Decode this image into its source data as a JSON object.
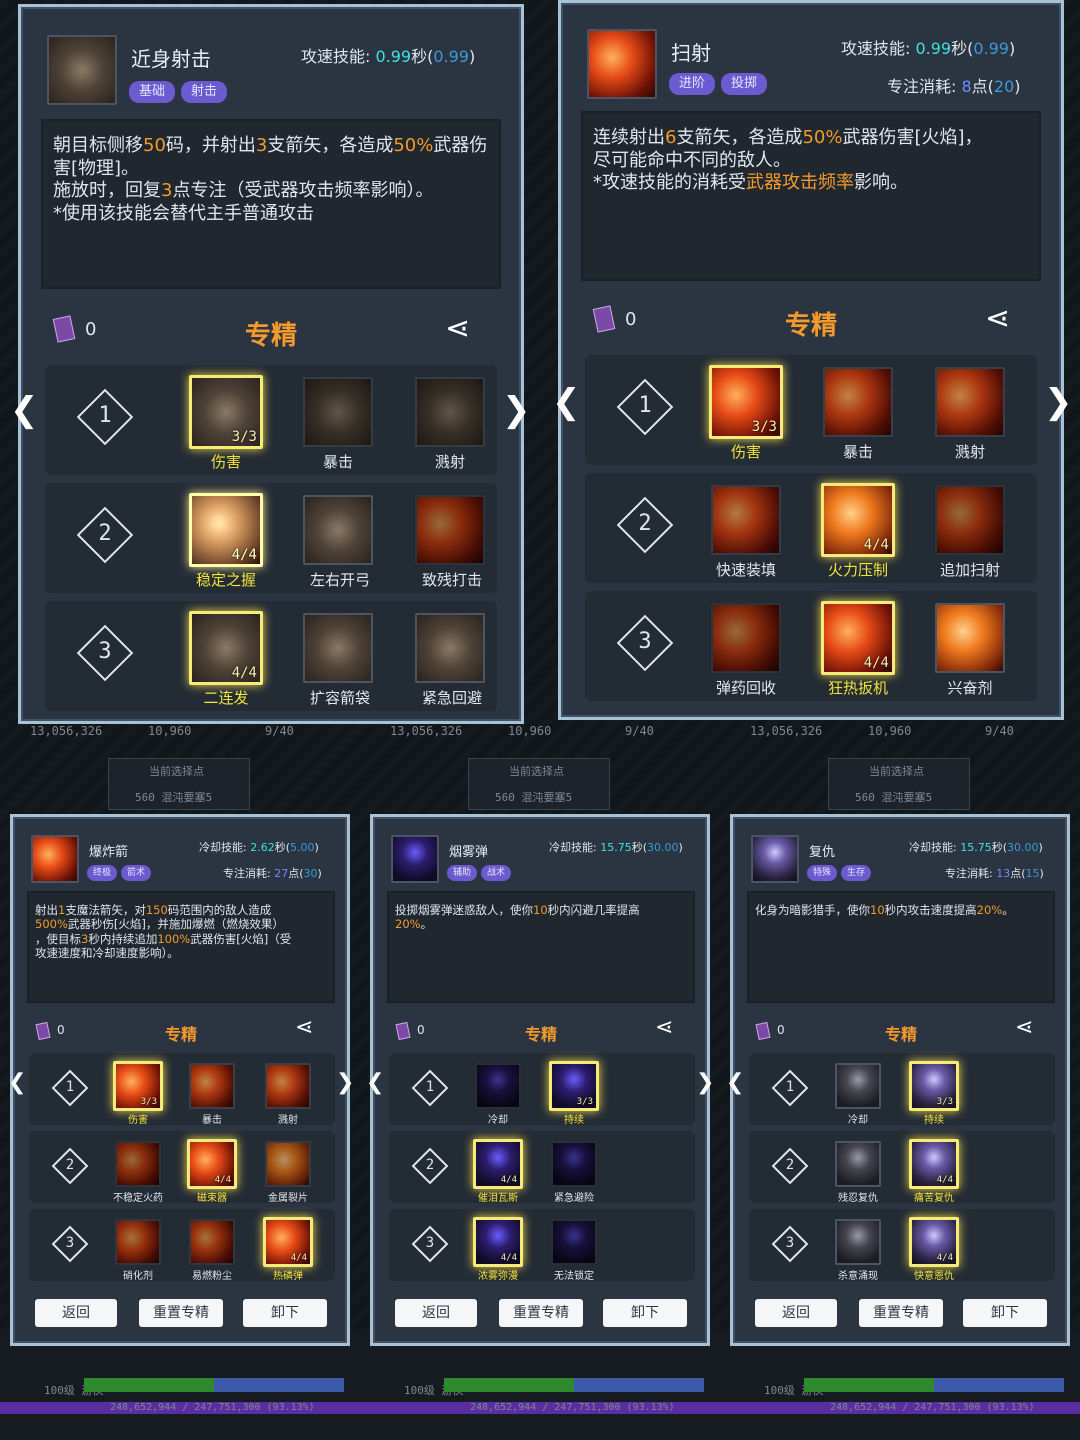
{
  "top_left": {
    "title": "近身射击",
    "cost_label": "攻速技能: ",
    "cost_val": "0.99",
    "cost_unit": "秒(",
    "cost_base": "0.99",
    "cost_close": ")",
    "tags": [
      "基础",
      "射击"
    ],
    "desc_parts": [
      "朝目标侧移",
      "50",
      "码，并射出",
      "3",
      "支箭矢，各造成",
      "50%",
      "武器伤害[物理]。",
      "施放时，回复",
      "3",
      "点专注（受武器攻击频率影响）。",
      "*使用该技能会替代主手普通攻击"
    ],
    "book": "0",
    "spec": "专精",
    "rows": [
      {
        "n": "1",
        "items": [
          {
            "name": "伤害",
            "count": "3/3",
            "sel": true
          },
          {
            "name": "暴击"
          },
          {
            "name": "溅射"
          }
        ]
      },
      {
        "n": "2",
        "items": [
          {
            "name": "稳定之握",
            "count": "4/4",
            "sel": true
          },
          {
            "name": "左右开弓"
          },
          {
            "name": "致残打击"
          }
        ]
      },
      {
        "n": "3",
        "items": [
          {
            "name": "二连发",
            "count": "4/4",
            "sel": true
          },
          {
            "name": "扩容箭袋"
          },
          {
            "name": "紧急回避"
          }
        ]
      }
    ]
  },
  "top_right": {
    "title": "扫射",
    "cost_label": "攻速技能: ",
    "cost_val": "0.99",
    "cost_unit": "秒(",
    "cost_base": "0.99",
    "cost_close": ")",
    "focus_label": "专注消耗: ",
    "focus_val": "8",
    "focus_unit": "点(",
    "focus_base": "20",
    "focus_close": ")",
    "tags": [
      "进阶",
      "投掷"
    ],
    "desc_parts": [
      "连续射出",
      "6",
      "支箭矢，各造成",
      "50%",
      "武器伤害[火焰]，",
      "尽可能命中不同的敌人。",
      "*攻速技能的消耗受",
      "武器攻击频率",
      "影响。"
    ],
    "book": "0",
    "spec": "专精",
    "rows": [
      {
        "n": "1",
        "items": [
          {
            "name": "伤害",
            "count": "3/3",
            "sel": true
          },
          {
            "name": "暴击"
          },
          {
            "name": "溅射"
          }
        ]
      },
      {
        "n": "2",
        "items": [
          {
            "name": "快速装填"
          },
          {
            "name": "火力压制",
            "count": "4/4",
            "sel": true
          },
          {
            "name": "追加扫射"
          }
        ]
      },
      {
        "n": "3",
        "items": [
          {
            "name": "弹药回收"
          },
          {
            "name": "狂热扳机",
            "count": "4/4",
            "sel": true
          },
          {
            "name": "兴奋剂"
          }
        ]
      }
    ]
  },
  "b1": {
    "title": "爆炸箭",
    "cost_label": "冷却技能: ",
    "cost_val": "2.62",
    "cost_unit": "秒(",
    "cost_base": "5.00",
    "cost_close": ")",
    "focus_label": "专注消耗: ",
    "focus_val": "27",
    "focus_unit": "点(",
    "focus_base": "30",
    "focus_close": ")",
    "tags": [
      "终极",
      "箭术"
    ],
    "desc_parts": [
      "射出",
      "1",
      "支魔法箭矢，对",
      "150",
      "码范围内的敌人造成",
      "500%",
      "武器秒伤[火焰]，并施加爆燃（燃烧效果）",
      "，使目标",
      "3",
      "秒内持续追加",
      "100%",
      "武器伤害[火焰]（受",
      "攻速速度和冷却速度影响）。"
    ],
    "book": "0",
    "spec": "专精",
    "rows": [
      {
        "n": "1",
        "items": [
          {
            "name": "伤害",
            "count": "3/3",
            "sel": true
          },
          {
            "name": "暴击"
          },
          {
            "name": "溅射"
          }
        ]
      },
      {
        "n": "2",
        "items": [
          {
            "name": "不稳定火药"
          },
          {
            "name": "磁束器",
            "count": "4/4",
            "sel": true
          },
          {
            "name": "金属裂片"
          }
        ]
      },
      {
        "n": "3",
        "items": [
          {
            "name": "硝化剂"
          },
          {
            "name": "易燃粉尘"
          },
          {
            "name": "热磷弹",
            "count": "4/4",
            "sel": true
          }
        ]
      }
    ],
    "buttons": [
      "返回",
      "重置专精",
      "卸下"
    ]
  },
  "b2": {
    "title": "烟雾弹",
    "cost_label": "冷却技能: ",
    "cost_val": "15.75",
    "cost_unit": "秒(",
    "cost_base": "30.00",
    "cost_close": ")",
    "tags": [
      "辅助",
      "战术"
    ],
    "desc_parts": [
      "投掷烟雾弹迷惑敌人，使你",
      "10",
      "秒内闪避几率提高",
      "20%",
      "。"
    ],
    "book": "0",
    "spec": "专精",
    "rows": [
      {
        "n": "1",
        "items": [
          {
            "name": "冷却"
          },
          {
            "name": "持续",
            "count": "3/3",
            "sel": true
          }
        ]
      },
      {
        "n": "2",
        "items": [
          {
            "name": "催泪瓦斯",
            "count": "4/4",
            "sel": true
          },
          {
            "name": "紧急避险"
          }
        ]
      },
      {
        "n": "3",
        "items": [
          {
            "name": "浓雾弥漫",
            "count": "4/4",
            "sel": true
          },
          {
            "name": "无法锁定"
          }
        ]
      }
    ],
    "buttons": [
      "返回",
      "重置专精",
      "卸下"
    ]
  },
  "b3": {
    "title": "复仇",
    "cost_label": "冷却技能: ",
    "cost_val": "15.75",
    "cost_unit": "秒(",
    "cost_base": "30.00",
    "cost_close": ")",
    "focus_label": "专注消耗: ",
    "focus_val": "13",
    "focus_unit": "点(",
    "focus_base": "15",
    "focus_close": ")",
    "tags": [
      "特殊",
      "生存"
    ],
    "desc_parts": [
      "化身为暗影猎手，使你",
      "10",
      "秒内攻击速度提高",
      "20%",
      "。"
    ],
    "book": "0",
    "spec": "专精",
    "rows": [
      {
        "n": "1",
        "items": [
          {
            "name": "冷却"
          },
          {
            "name": "持续",
            "count": "3/3",
            "sel": true
          }
        ]
      },
      {
        "n": "2",
        "items": [
          {
            "name": "残忍复仇"
          },
          {
            "name": "痛苦复仇",
            "count": "4/4",
            "sel": true
          }
        ]
      },
      {
        "n": "3",
        "items": [
          {
            "name": "杀意涌现"
          },
          {
            "name": "快意恩仇",
            "count": "4/4",
            "sel": true
          }
        ]
      }
    ],
    "buttons": [
      "返回",
      "重置专精",
      "卸下"
    ]
  },
  "bg": {
    "gold": "13,056,326",
    "gems": "10,960",
    "slots": "9/40",
    "sub_label": "当前选择点",
    "sub_btn": "560 混沌要塞5",
    "level": "100级 游侠",
    "exp": "248,652,944 / 247,751,300 (93.13%)"
  }
}
